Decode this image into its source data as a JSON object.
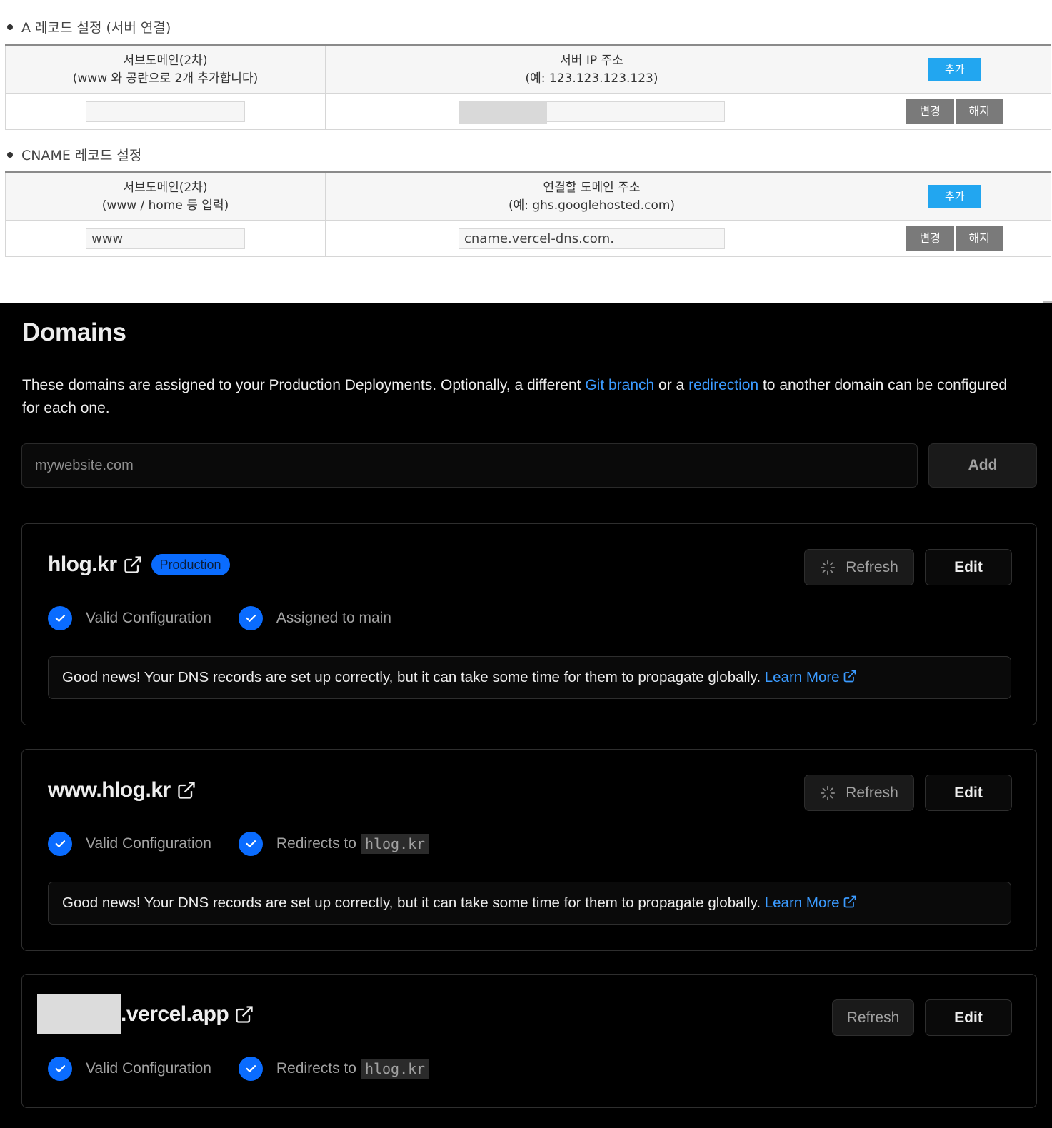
{
  "a_record": {
    "title": "A 레코드 설정 (서버 연결)",
    "col1_line1": "서브도메인(2차)",
    "col1_line2": "(www 와 공란으로 2개 추가합니다)",
    "col2_line1": "서버 IP 주소",
    "col2_line2": "(예: 123.123.123.123)",
    "add_label": "추가",
    "row": {
      "subdomain": "",
      "ip": ""
    },
    "change_label": "변경",
    "remove_label": "해지"
  },
  "cname_record": {
    "title": "CNAME 레코드 설정",
    "col1_line1": "서브도메인(2차)",
    "col1_line2": "(www / home 등 입력)",
    "col2_line1": "연결할 도메인 주소",
    "col2_line2": "(예: ghs.googlehosted.com)",
    "add_label": "추가",
    "row": {
      "subdomain": "www",
      "target": "cname.vercel-dns.com."
    },
    "change_label": "변경",
    "remove_label": "해지"
  },
  "domains": {
    "title": "Domains",
    "desc_part1": "These domains are assigned to your Production Deployments. Optionally, a different ",
    "desc_link1": "Git branch",
    "desc_part2": " or a ",
    "desc_link2": "redirection",
    "desc_part3": " to another domain can be configured for each one.",
    "input_placeholder": "mywebsite.com",
    "add_label": "Add",
    "cards": [
      {
        "name": "hlog.kr",
        "badge": "Production",
        "refresh_label": "Refresh",
        "edit_label": "Edit",
        "status1": "Valid Configuration",
        "status2": "Assigned to main",
        "notice": "Good news! Your DNS records are set up correctly, but it can take some time for them to propagate globally.",
        "learn_more": "Learn More"
      },
      {
        "name": "www.hlog.kr",
        "refresh_label": "Refresh",
        "edit_label": "Edit",
        "status1": "Valid Configuration",
        "status2_prefix": "Redirects to",
        "status2_code": "hlog.kr",
        "notice": "Good news! Your DNS records are set up correctly, but it can take some time for them to propagate globally.",
        "learn_more": "Learn More"
      },
      {
        "name": ".vercel.app",
        "refresh_label": "Refresh",
        "edit_label": "Edit",
        "status1": "Valid Configuration",
        "status2_prefix": "Redirects to",
        "status2_code": "hlog.kr"
      }
    ]
  },
  "colors": {
    "accent_blue": "#0a6cff",
    "link_blue": "#3b9bff",
    "kr_add_button": "#22a6f0",
    "kr_gray_button": "#7a7a7a"
  }
}
